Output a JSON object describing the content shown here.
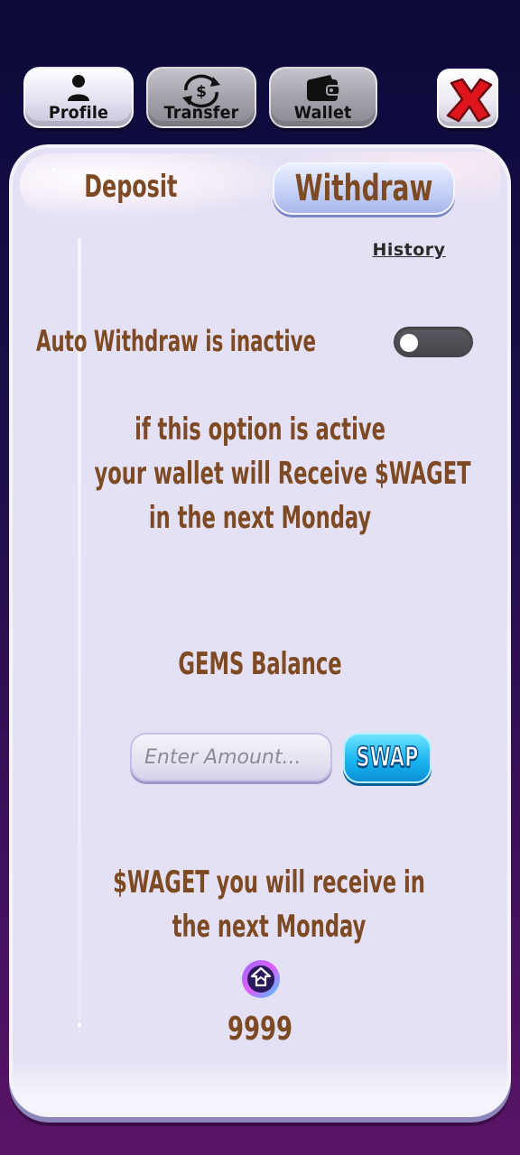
{
  "top_tabs": [
    {
      "label": "Profile",
      "icon": "user-icon",
      "active": true
    },
    {
      "label": "Transfer",
      "icon": "dollar-exchange-icon",
      "active": false
    },
    {
      "label": "Wallet",
      "icon": "wallet-icon",
      "active": false
    }
  ],
  "close_icon": "close-icon",
  "subtabs": {
    "deposit": "Deposit",
    "withdraw": "Withdraw",
    "active": "Withdraw"
  },
  "history_link": "History",
  "auto_withdraw": {
    "label": "Auto Withdraw is inactive",
    "enabled": false
  },
  "info_lines": [
    "if this option is active",
    "your wallet will Receive $WAGET",
    "in the next Monday"
  ],
  "gems": {
    "title": "GEMS Balance",
    "amount_placeholder": "Enter Amount...",
    "swap_label": "SWAP"
  },
  "receive": {
    "lines": [
      "$WAGET you will receive in",
      "the next Monday"
    ],
    "token_icon": "waget-token-icon",
    "value": "9999"
  },
  "colors": {
    "text_brown": "#7e4a24",
    "panel_bg": "#e4e1f4",
    "swap_blue": "#19b6f0",
    "close_red": "#e0141c"
  }
}
